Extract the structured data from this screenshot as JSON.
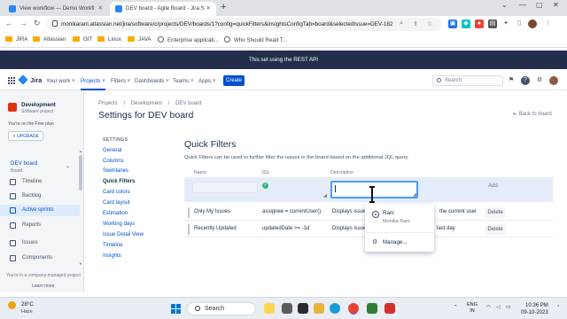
{
  "browser": {
    "tabs": [
      {
        "title": "View workflow — Demo Workfl",
        "active": false
      },
      {
        "title": "DEV board - Agile Board - Jira S",
        "active": true
      }
    ],
    "new_tab": "+",
    "url": "monikarani.atlassian.net/jira/software/c/projects/DEV/boards/1?config=quickFilters&insightsConfigTab=board&selectedIssue=DEV-182",
    "bookmarks": [
      "JIRA",
      "Atlassian",
      "GIT",
      "Linux",
      "JAVA",
      "Enterprise applicati...",
      "Who Should Read T..."
    ]
  },
  "banner": "This set using the REST API",
  "jira_nav": {
    "logo": "Jira",
    "menus": [
      "Your work",
      "Projects",
      "Filters",
      "Dashboards",
      "Teams",
      "Apps"
    ],
    "active_menu": "Projects",
    "create": "Create",
    "search_placeholder": "Search"
  },
  "sidebar": {
    "project_name": "Development",
    "project_type": "Software project",
    "free_plan": "You're on the Free plan",
    "upgrade": "UPGRADE",
    "board_name": "DEV board",
    "board_sub": "Board",
    "items": [
      {
        "label": "Timeline",
        "active": false
      },
      {
        "label": "Backlog",
        "active": false
      },
      {
        "label": "Active sprints",
        "active": true
      },
      {
        "label": "Reports",
        "active": false
      },
      {
        "label": "Issues",
        "active": false
      },
      {
        "label": "Components",
        "active": false
      }
    ],
    "company_managed": "You're in a company-managed project",
    "learn_more": "Learn more"
  },
  "main": {
    "breadcrumb": [
      "Projects",
      "/",
      "Development",
      "/",
      "DEV board"
    ],
    "title": "Settings for DEV board",
    "back": "Back to board",
    "settings_heading": "SETTINGS",
    "settings_nav": [
      "General",
      "Columns",
      "Swimlanes",
      "Quick Filters",
      "Card colors",
      "Card layout",
      "Estimation",
      "Working days",
      "Issue Detail View",
      "Timeline",
      "Insights"
    ],
    "active_setting": "Quick Filters",
    "quick_filters": {
      "title": "Quick Filters",
      "description": "Quick Filters can be used to further filter the issues in the board based on the additional JQL query.",
      "columns": {
        "name": "Name",
        "jql": "JQL",
        "description": "Description"
      },
      "add": "Add",
      "rows": [
        {
          "name": "Only My Issues",
          "jql": "assignee = currentUser()",
          "description_start": "Displays issues",
          "description_end": "the current user",
          "delete": "Delete"
        },
        {
          "name": "Recently Updated",
          "jql": "updatedDate >= -1d",
          "description_start": "Displays issues",
          "description_end": "last day",
          "delete": "Delete"
        }
      ]
    },
    "mention_dropdown": {
      "name": "Rani",
      "full_name": "Monika Rani",
      "manage": "Manage..."
    }
  },
  "taskbar": {
    "temperature": "28°C",
    "condition": "Haze",
    "search": "Search",
    "lang_1": "ENG",
    "lang_2": "IN",
    "time": "10:36 PM",
    "date": "09-10-2023"
  },
  "colors": {
    "banner_bg": "#232e4b",
    "jira_blue": "#0052cc",
    "active_nav_bg": "#deebff",
    "new_row_bg": "#e4ecfa",
    "focus_ring": "#4c9aff"
  }
}
